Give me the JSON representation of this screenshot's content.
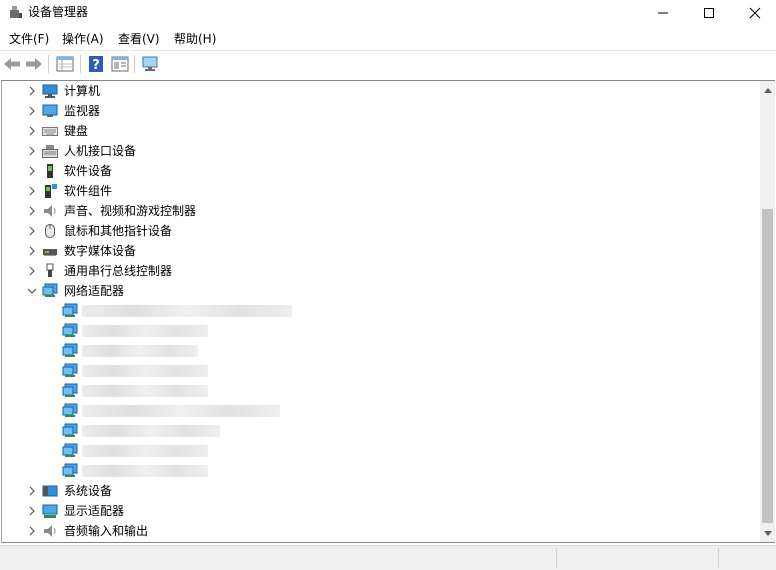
{
  "window": {
    "title": "设备管理器",
    "controls": {
      "minimize": "minimize-icon",
      "maximize": "maximize-icon",
      "close": "close-icon"
    }
  },
  "menu": [
    {
      "label": "文件(F)"
    },
    {
      "label": "操作(A)"
    },
    {
      "label": "查看(V)"
    },
    {
      "label": "帮助(H)"
    }
  ],
  "toolbar": {
    "icons": [
      "back-arrow-icon",
      "forward-arrow-icon",
      "properties-grid-icon",
      "help-icon",
      "action-pane-icon",
      "monitor-scan-icon"
    ]
  },
  "tree": {
    "categories_top": [
      {
        "label": "计算机",
        "icon": "computer-icon"
      },
      {
        "label": "监视器",
        "icon": "monitor-icon"
      },
      {
        "label": "键盘",
        "icon": "keyboard-icon"
      },
      {
        "label": "人机接口设备",
        "icon": "hid-icon"
      },
      {
        "label": "软件设备",
        "icon": "software-device-icon"
      },
      {
        "label": "软件组件",
        "icon": "software-component-icon"
      },
      {
        "label": "声音、视频和游戏控制器",
        "icon": "speaker-icon"
      },
      {
        "label": "鼠标和其他指针设备",
        "icon": "mouse-icon"
      },
      {
        "label": "数字媒体设备",
        "icon": "digital-media-icon"
      },
      {
        "label": "通用串行总线控制器",
        "icon": "usb-icon"
      }
    ],
    "expanded_category": {
      "label": "网络适配器",
      "icon": "network-adapter-icon",
      "expanded": true
    },
    "network_adapters_count_visible": 9,
    "categories_bottom": [
      {
        "label": "系统设备",
        "icon": "system-device-icon"
      },
      {
        "label": "显示适配器",
        "icon": "display-adapter-icon"
      },
      {
        "label": "音频输入和输出",
        "icon": "audio-io-icon"
      }
    ]
  },
  "colors": {
    "accent_blue": "#2f8fdc",
    "scroll_thumb": "#c2c2c2",
    "statusbar_bg": "#f0f0f0"
  }
}
